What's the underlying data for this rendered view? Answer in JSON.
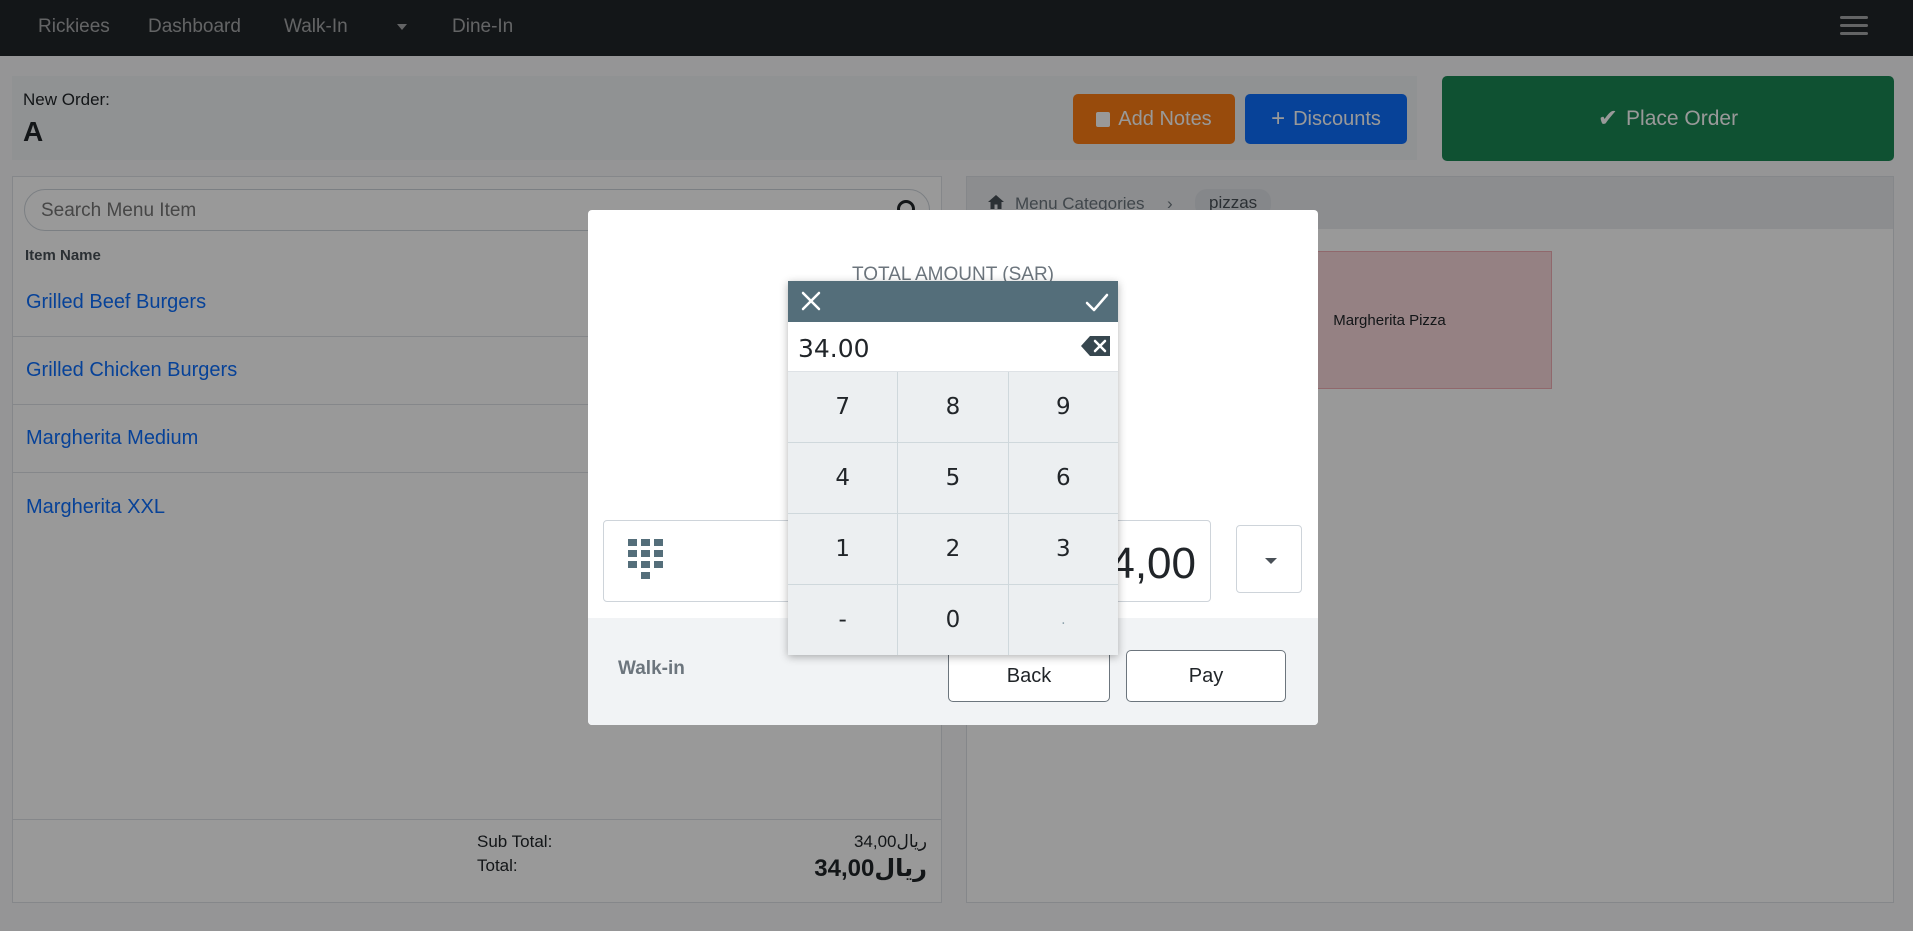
{
  "navbar": {
    "brand": "Rickiees",
    "links": [
      "Dashboard",
      "Walk-In",
      "Dine-In"
    ]
  },
  "order": {
    "new_order_label": "New Order:",
    "code": "A",
    "add_notes_label": "Add Notes",
    "discounts_label": "Discounts",
    "place_order_label": "Place Order"
  },
  "menu": {
    "search_placeholder": "Search Menu Item",
    "column_header": "Item Name",
    "items": [
      "Grilled Beef Burgers",
      "Grilled Chicken Burgers",
      "Margherita Medium",
      "Margherita XXL"
    ]
  },
  "totals": {
    "sub_total_label": "Sub Total:",
    "sub_total_value": "34,00ريال",
    "total_label": "Total:",
    "total_value": "34,00ريال"
  },
  "categories": {
    "root_label": "Menu Categories",
    "separator": "›",
    "current": "pizzas",
    "products": [
      "Margherita Pizza"
    ]
  },
  "payment_modal": {
    "title": "TOTAL AMOUNT (SAR)",
    "amount_visible_tail": "4,00",
    "customer_type": "Walk-in",
    "back_label": "Back",
    "pay_label": "Pay"
  },
  "numpad": {
    "display_value": "34.00",
    "keys": [
      "7",
      "8",
      "9",
      "4",
      "5",
      "6",
      "1",
      "2",
      "3",
      "-",
      "0",
      "."
    ]
  },
  "colors": {
    "navbar": "#212529",
    "notes_button": "#fd7e14",
    "discounts_button": "#0d6efd",
    "place_order_button": "#198754",
    "numpad_header": "#546e7a",
    "link": "#0d6efd"
  }
}
